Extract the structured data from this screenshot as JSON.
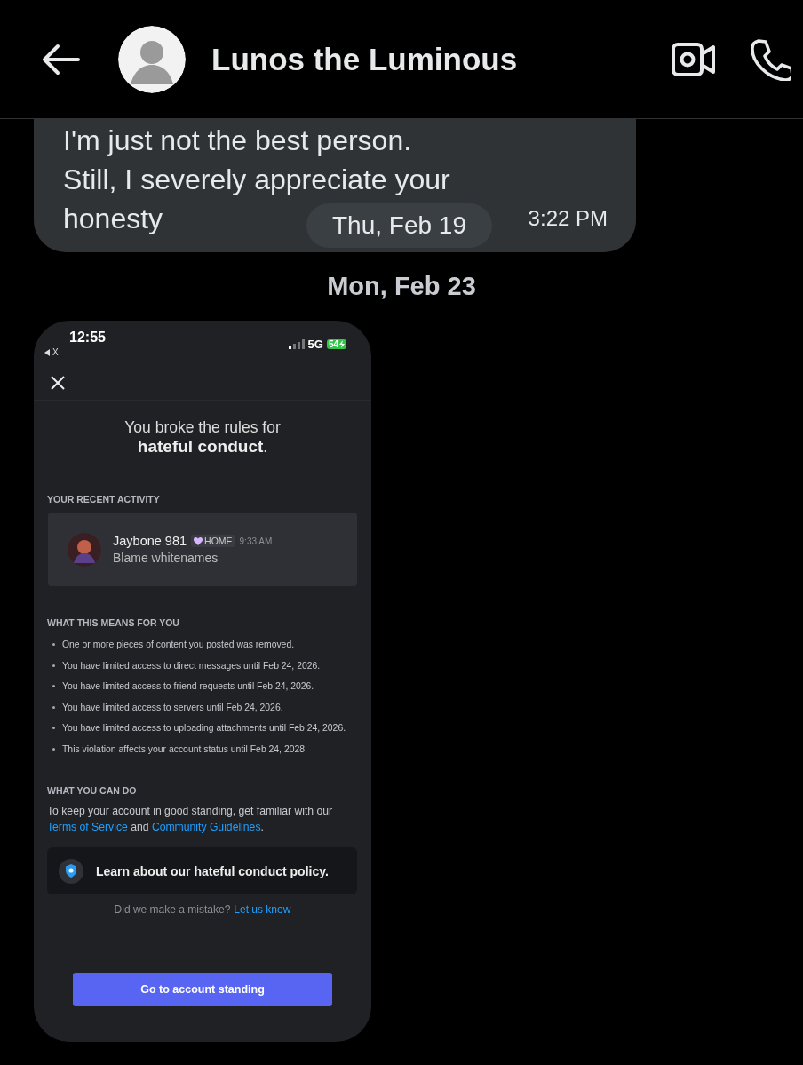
{
  "header": {
    "title": "Lunos the Luminous"
  },
  "floating_date": "Thu, Feb 19",
  "messages": [
    {
      "kind": "text",
      "lines": [
        "I'm just not the best person.",
        "Still, I severely appreciate your",
        "honesty"
      ],
      "time": "3:22 PM"
    },
    {
      "kind": "date",
      "text": "Mon, Feb 23"
    },
    {
      "kind": "screenshot",
      "status": {
        "time": "12:55",
        "back_app": "X",
        "network": "5G",
        "battery": "54"
      },
      "title": "You broke the rules for\n**hateful conduct**.",
      "recent_activity": {
        "heading": "YOUR RECENT ACTIVITY",
        "author": "Jaybone 981",
        "badge": "HOME",
        "time": "9:33 AM",
        "text": "Blame whitenames"
      },
      "means": {
        "heading": "WHAT THIS MEANS FOR YOU",
        "items": [
          "One or more pieces of content you posted was removed.",
          "You have limited access to direct messages until Feb 24, 2026.",
          "You have limited access to friend requests until Feb 24, 2026.",
          "You have limited access to servers until Feb 24, 2026.",
          "You have limited access to uploading attachments until Feb 24, 2026.",
          "This violation affects your account status until Feb 24, 2028"
        ]
      },
      "can_do": {
        "heading": "WHAT YOU CAN DO",
        "segments": [
          {
            "kind": "text",
            "text": "To keep your account in good standing, get familiar with our "
          },
          {
            "kind": "link",
            "text": "Terms of Service"
          },
          {
            "kind": "text",
            "text": " and "
          },
          {
            "kind": "link",
            "text": "Community Guidelines"
          },
          {
            "kind": "text",
            "text": "."
          }
        ]
      },
      "policy": "Learn about our hateful conduct policy.",
      "mistake": {
        "text": "Did we make a mistake?",
        "link": "Let us know"
      },
      "button": "Go to account standing"
    }
  ]
}
